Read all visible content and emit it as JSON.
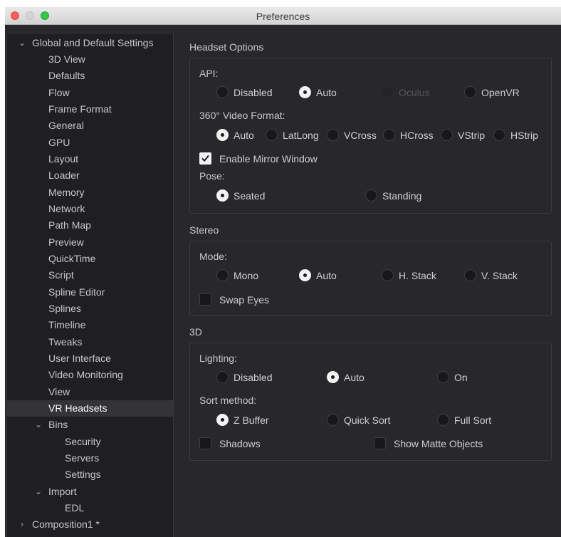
{
  "window": {
    "title": "Preferences"
  },
  "sidebar": {
    "items": [
      {
        "label": "Global and Default Settings",
        "expanded": true
      },
      {
        "label": "3D View"
      },
      {
        "label": "Defaults"
      },
      {
        "label": "Flow"
      },
      {
        "label": "Frame Format"
      },
      {
        "label": "General"
      },
      {
        "label": "GPU"
      },
      {
        "label": "Layout"
      },
      {
        "label": "Loader"
      },
      {
        "label": "Memory"
      },
      {
        "label": "Network"
      },
      {
        "label": "Path Map"
      },
      {
        "label": "Preview"
      },
      {
        "label": "QuickTime"
      },
      {
        "label": "Script"
      },
      {
        "label": "Spline Editor"
      },
      {
        "label": "Splines"
      },
      {
        "label": "Timeline"
      },
      {
        "label": "Tweaks"
      },
      {
        "label": "User Interface"
      },
      {
        "label": "Video Monitoring"
      },
      {
        "label": "View"
      },
      {
        "label": "VR Headsets",
        "selected": true
      },
      {
        "label": "Bins",
        "expanded": true
      },
      {
        "label": "Security"
      },
      {
        "label": "Servers"
      },
      {
        "label": "Settings"
      },
      {
        "label": "Import",
        "expanded": true
      },
      {
        "label": "EDL"
      },
      {
        "label": "Composition1 *",
        "expanded": false
      }
    ]
  },
  "headset": {
    "title": "Headset Options",
    "api_label": "API:",
    "api_options": [
      "Disabled",
      "Auto",
      "Oculus",
      "OpenVR"
    ],
    "api_selected": "Auto",
    "api_disabled": [
      "Oculus"
    ],
    "video_format_label": "360° Video Format:",
    "video_format_options": [
      "Auto",
      "LatLong",
      "VCross",
      "HCross",
      "VStrip",
      "HStrip"
    ],
    "video_format_selected": "Auto",
    "mirror_label": "Enable Mirror Window",
    "mirror_checked": true,
    "pose_label": "Pose:",
    "pose_options": [
      "Seated",
      "Standing"
    ],
    "pose_selected": "Seated"
  },
  "stereo": {
    "title": "Stereo",
    "mode_label": "Mode:",
    "mode_options": [
      "Mono",
      "Auto",
      "H. Stack",
      "V. Stack"
    ],
    "mode_selected": "Auto",
    "swap_label": "Swap Eyes",
    "swap_checked": false
  },
  "threed": {
    "title": "3D",
    "lighting_label": "Lighting:",
    "lighting_options": [
      "Disabled",
      "Auto",
      "On"
    ],
    "lighting_selected": "Auto",
    "sort_label": "Sort method:",
    "sort_options": [
      "Z Buffer",
      "Quick Sort",
      "Full Sort"
    ],
    "sort_selected": "Z Buffer",
    "shadows_label": "Shadows",
    "shadows_checked": false,
    "matte_label": "Show Matte Objects",
    "matte_checked": false
  }
}
